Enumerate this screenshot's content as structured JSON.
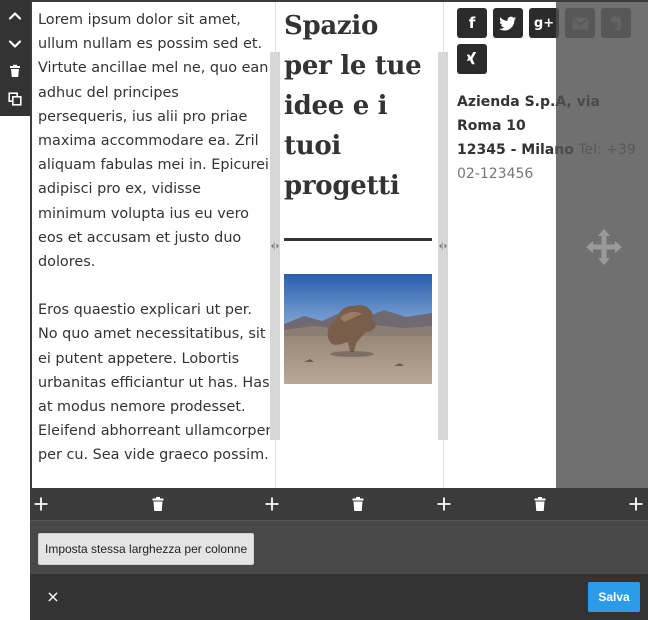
{
  "left_toolbar": {
    "items": [
      {
        "icon": "chevron-up-icon"
      },
      {
        "icon": "chevron-down-icon"
      },
      {
        "icon": "trash-icon"
      },
      {
        "icon": "duplicate-icon"
      }
    ]
  },
  "column1": {
    "paragraphs": [
      "Lorem ipsum dolor sit amet, ullum nullam es possim sed et. Virtute ancillae mel ne, quo ean adhuc del principes persequeris, ius alii pro priae maxima accommodare ea. Zril aliquam fabulas mei in. Epicurei adipisci pro ex, vidisse minimum volupta ius eu vero eos et accusam et justo duo dolores.",
      "Eros quaestio explicari ut per. No quo amet necessitatibus, sit ei putent appetere. Lobortis urbanitas efficiantur ut has. Has at modus nemore prodesset. Eleifend abhorreant ullamcorper per cu. Sea vide graeco possim."
    ]
  },
  "column2": {
    "heading": "Spazio per le tue idee e i tuoi progetti",
    "image_subject": "desert rock formation"
  },
  "column3": {
    "social": [
      {
        "label": "f",
        "icon": "facebook-icon"
      },
      {
        "label": "",
        "icon": "twitter-icon"
      },
      {
        "label": "g+",
        "icon": "google-plus-icon"
      },
      {
        "label": "",
        "icon": "email-icon"
      },
      {
        "label": "",
        "icon": "evernote-icon"
      },
      {
        "label": "",
        "icon": "xing-icon"
      }
    ],
    "address_line1": "Azienda S.p.A, via Roma 10",
    "address_line2": "12345 - Milano",
    "phone": "Tel: +39 02-123456"
  },
  "actions": {
    "same_width_label": "Imposta stessa larghezza per colonne",
    "close_label": "×",
    "save_label": "Salva"
  },
  "colors": {
    "toolbar_bg": "#333333",
    "save_bg": "#2d9be8",
    "text": "#333333"
  }
}
